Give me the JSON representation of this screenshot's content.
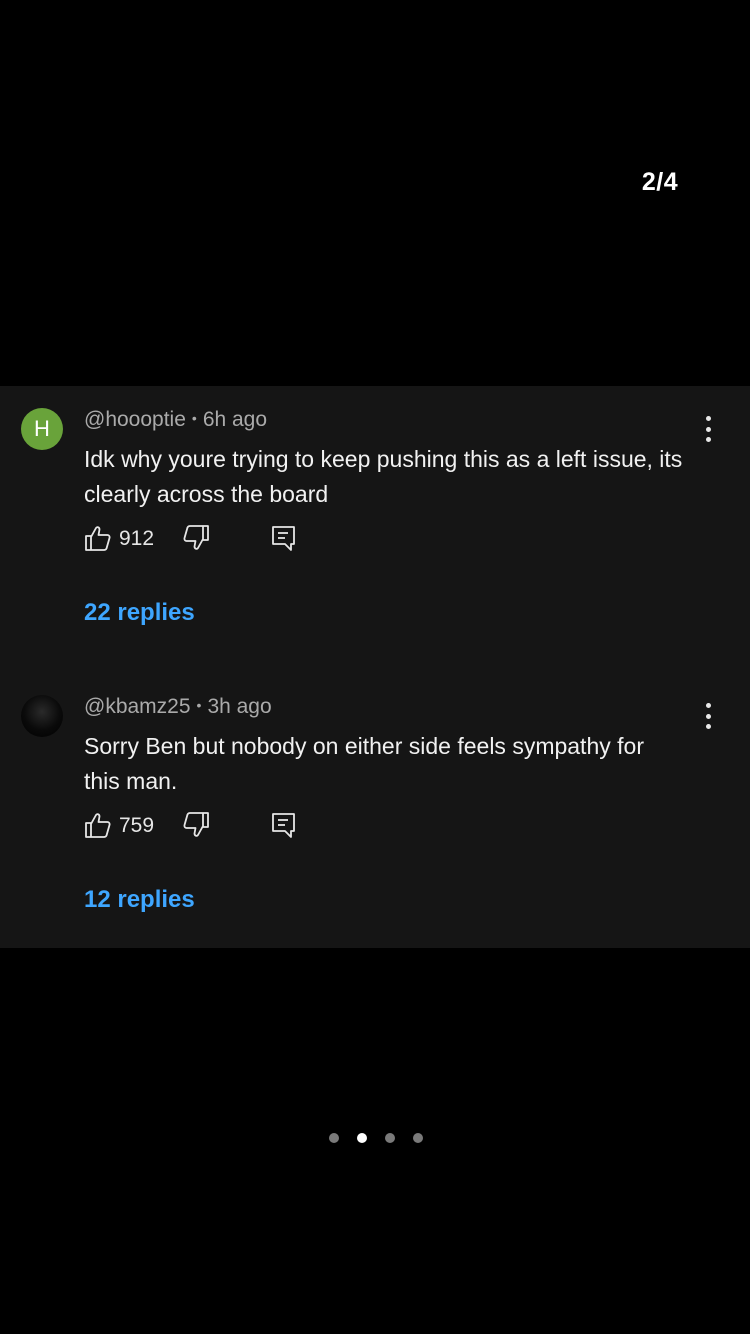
{
  "page_counter": "2/4",
  "comments": [
    {
      "avatar_letter": "H",
      "avatar_color": "#69a33a",
      "author": "@hoooptie",
      "time": "6h ago",
      "text": "Idk why youre trying to keep pushing this as a left issue, its clearly across the board",
      "likes": "912",
      "replies": "22 replies"
    },
    {
      "avatar_letter": "",
      "author": "@kbamz25",
      "time": "3h ago",
      "text": "Sorry Ben but nobody on either side feels sympathy for this man.",
      "likes": "759",
      "replies": "12 replies"
    }
  ],
  "meta_separator": "•",
  "pagination": {
    "total": 4,
    "active_index": 1
  },
  "colors": {
    "background": "#000000",
    "panel": "#151515",
    "link": "#3ea6ff"
  }
}
